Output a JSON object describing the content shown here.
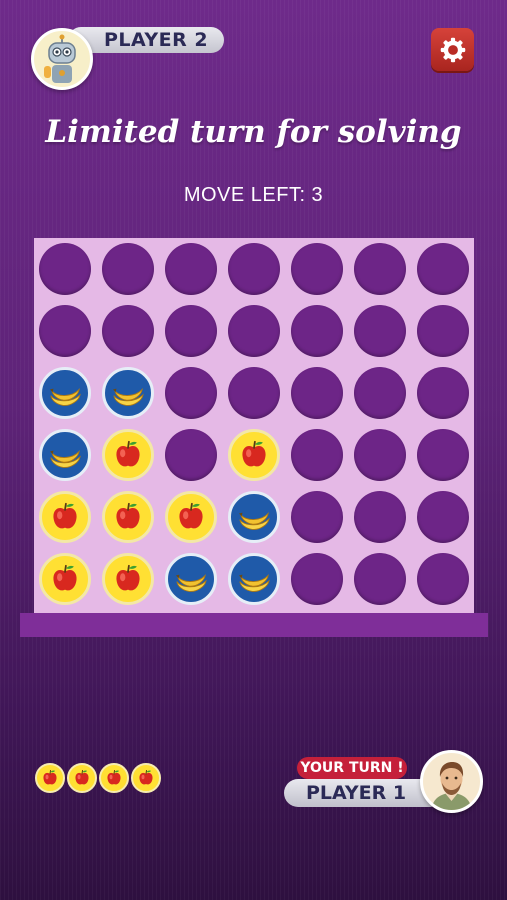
{
  "header": {
    "opponent_name": "PLAYER 2",
    "opponent_avatar": "robot-avatar-icon",
    "settings_icon": "gear-icon"
  },
  "title": "Limited turn for solving",
  "moves_left": "MOVE LEFT: 3",
  "board": {
    "columns": 7,
    "rows": 6,
    "grid": [
      [
        "empty",
        "empty",
        "empty",
        "empty",
        "empty",
        "empty",
        "empty"
      ],
      [
        "empty",
        "empty",
        "empty",
        "empty",
        "empty",
        "empty",
        "empty"
      ],
      [
        "banana",
        "banana",
        "empty",
        "empty",
        "empty",
        "empty",
        "empty"
      ],
      [
        "banana",
        "apple",
        "empty",
        "apple",
        "empty",
        "empty",
        "empty"
      ],
      [
        "apple",
        "apple",
        "apple",
        "banana",
        "empty",
        "empty",
        "empty"
      ],
      [
        "apple",
        "apple",
        "banana",
        "banana",
        "empty",
        "empty",
        "empty"
      ]
    ]
  },
  "footer": {
    "remaining_tokens": 4,
    "token_type": "apple",
    "turn_badge": "YOUR TURN !",
    "player_name": "PLAYER 1",
    "player_avatar": "man-avatar-icon"
  },
  "colors": {
    "banana_piece": "#1f5aa9",
    "apple_piece": "#ffe033",
    "empty_slot": "#6d2587",
    "board": "#e5b9e6",
    "turn_badge": "#c5203a",
    "settings_button": "#c2352e"
  }
}
